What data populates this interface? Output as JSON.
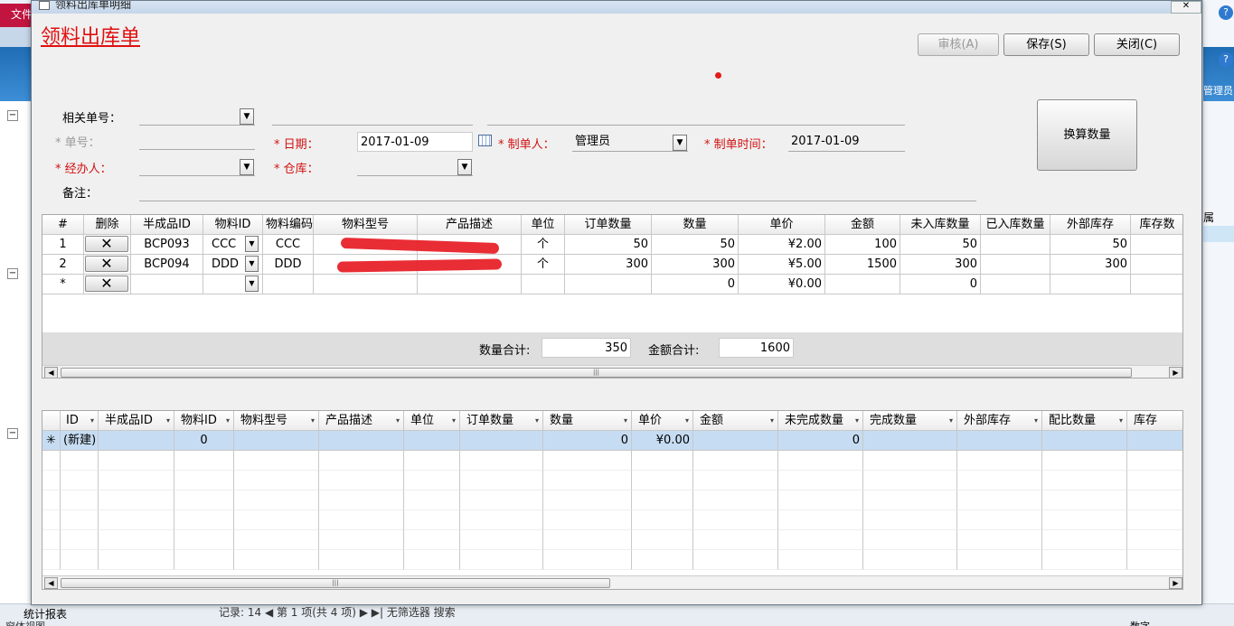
{
  "background": {
    "file_tab": "文件",
    "admin_label": "管理员",
    "prop_label": "属",
    "status_left": "统计报表",
    "status_footer": "窗体视图",
    "record_nav": "记录: 14 ◀  第 1 项(共 4 项)  ▶ ▶|  无筛选器  搜索",
    "status_right": "数字"
  },
  "dialog": {
    "title": "领料出库单明细",
    "close_glyph": "✕",
    "form_title": "领料出库单",
    "buttons": {
      "review": "审核(A)",
      "save": "保存(S)",
      "close": "关闭(C)",
      "convert": "换算数量"
    },
    "fields": {
      "related_no_label": "相关单号：",
      "related_no_value": "",
      "order_no_label": "* 单号：",
      "order_no_value": "",
      "date_label": "* 日期：",
      "date_value": "2017-01-09",
      "maker_label": "* 制单人：",
      "maker_value": "管理员",
      "make_time_label": "* 制单时间：",
      "make_time_value": "2017-01-09",
      "handler_label": "* 经办人：",
      "handler_value": "",
      "warehouse_label": "* 仓库：",
      "warehouse_value": "",
      "remark_label": "备注：",
      "remark_value": ""
    },
    "upper_grid": {
      "headers": [
        "#",
        "删除",
        "半成品ID",
        "物料ID",
        "物料编码",
        "物料型号",
        "产品描述",
        "单位",
        "订单数量",
        "数量",
        "单价",
        "金额",
        "未入库数量",
        "已入库数量",
        "外部库存",
        "库存数"
      ],
      "rows": [
        {
          "no": "1",
          "del": "✕",
          "semi_id": "BCP093",
          "mat_id": "CCC",
          "mat_code": "CCC",
          "model": "",
          "desc": "",
          "unit": "个",
          "order_qty": "50",
          "qty": "50",
          "price": "¥2.00",
          "amount": "100",
          "not_in": "50",
          "in": "",
          "ext": "50",
          "stock": ""
        },
        {
          "no": "2",
          "del": "✕",
          "semi_id": "BCP094",
          "mat_id": "DDD",
          "mat_code": "DDD",
          "model": "",
          "desc": "",
          "unit": "个",
          "order_qty": "300",
          "qty": "300",
          "price": "¥5.00",
          "amount": "1500",
          "not_in": "300",
          "in": "",
          "ext": "300",
          "stock": ""
        },
        {
          "no": "*",
          "del": "✕",
          "semi_id": "",
          "mat_id": "",
          "mat_code": "",
          "model": "",
          "desc": "",
          "unit": "",
          "order_qty": "",
          "qty": "0",
          "price": "¥0.00",
          "amount": "",
          "not_in": "0",
          "in": "",
          "ext": "",
          "stock": ""
        }
      ],
      "qty_total_label": "数量合计:",
      "qty_total_value": "350",
      "amount_total_label": "金额合计:",
      "amount_total_value": "1600"
    },
    "lower_grid": {
      "headers": [
        "ID",
        "半成品ID",
        "物料ID",
        "物料型号",
        "产品描述",
        "单位",
        "订单数量",
        "数量",
        "单价",
        "金额",
        "未完成数量",
        "完成数量",
        "外部库存",
        "配比数量",
        "库存"
      ],
      "new_row": {
        "marker": "✳",
        "id": "(新建)",
        "mat_id": "0",
        "qty": "0",
        "price": "¥0.00",
        "unfinished": "0"
      }
    },
    "redaction_color": "#e8222a",
    "title_color": "#e01010"
  }
}
